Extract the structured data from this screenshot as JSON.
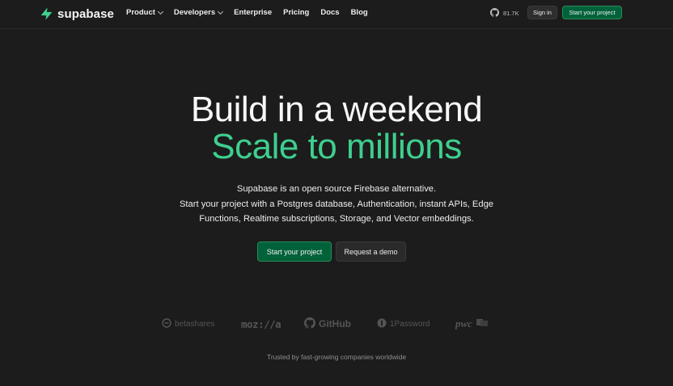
{
  "brand": {
    "name": "supabase",
    "accent_color": "#3ecf8e",
    "button_green": "#006239"
  },
  "nav": {
    "items": [
      {
        "label": "Product",
        "has_dropdown": true
      },
      {
        "label": "Developers",
        "has_dropdown": true
      },
      {
        "label": "Enterprise",
        "has_dropdown": false
      },
      {
        "label": "Pricing",
        "has_dropdown": false
      },
      {
        "label": "Docs",
        "has_dropdown": false
      },
      {
        "label": "Blog",
        "has_dropdown": false
      }
    ],
    "github_stars": "81.7K",
    "github_icon": "github-icon",
    "signin_label": "Sign in",
    "start_label": "Start your project"
  },
  "hero": {
    "line1": "Build in a weekend",
    "line2": "Scale to millions",
    "subtitle_lines": [
      "Supabase is an open source Firebase alternative.",
      "Start your project with a Postgres database, Authentication, instant APIs, Edge",
      "Functions, Realtime subscriptions, Storage, and Vector embeddings."
    ],
    "primary_button": "Start your project",
    "secondary_button": "Request a demo"
  },
  "logos": {
    "items": [
      "betashares",
      "moz://a",
      "GitHub",
      "1Password",
      "pwc"
    ],
    "caption": "Trusted by fast-growing companies worldwide"
  }
}
